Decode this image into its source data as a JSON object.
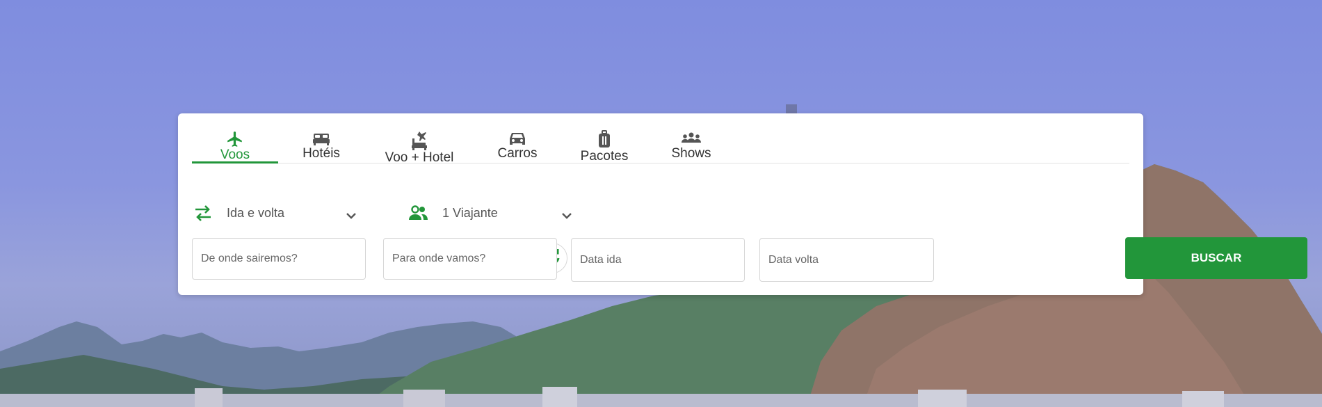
{
  "tabs": [
    {
      "label": "Voos",
      "icon": "airplane-icon"
    },
    {
      "label": "Hotéis",
      "icon": "bed-icon"
    },
    {
      "label": "Voo + Hotel",
      "icon": "flight-hotel-icon"
    },
    {
      "label": "Carros",
      "icon": "car-icon"
    },
    {
      "label": "Pacotes",
      "icon": "luggage-icon"
    },
    {
      "label": "Shows",
      "icon": "group-icon"
    }
  ],
  "active_tab": "Voos",
  "trip_type": {
    "value": "Ida e volta",
    "icon": "swap-arrows-icon"
  },
  "travelers": {
    "value": "1 Viajante",
    "icon": "people-icon"
  },
  "fields": {
    "origin_placeholder": "De onde sairemos?",
    "destination_placeholder": "Para onde vamos?",
    "departure_placeholder": "Data ida",
    "return_placeholder": "Data volta"
  },
  "search_button": "BUSCAR",
  "colors": {
    "accent": "#22963a",
    "hero_overlay": "#7f8ddf",
    "text": "#333333"
  }
}
